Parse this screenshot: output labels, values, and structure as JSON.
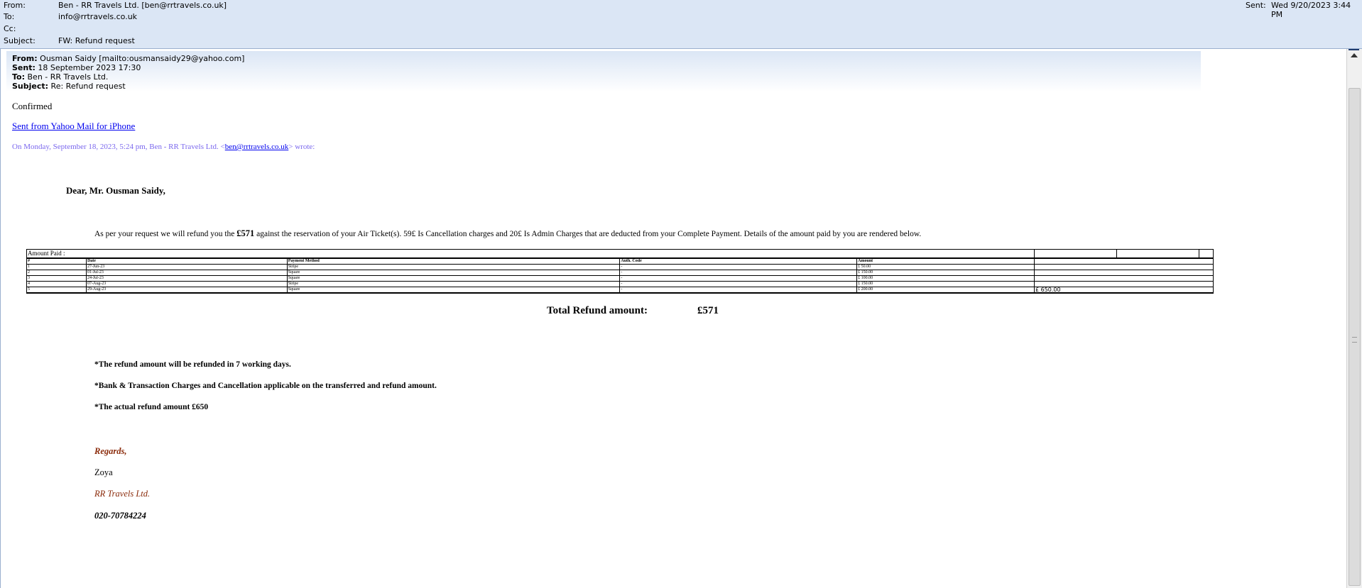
{
  "header": {
    "from_label": "From:",
    "from_value": "Ben - RR Travels Ltd. [ben@rrtravels.co.uk]",
    "to_label": "To:",
    "to_value": "info@rrtravels.co.uk",
    "cc_label": "Cc:",
    "cc_value": "",
    "subject_label": "Subject:",
    "subject_value": "FW: Refund request",
    "sent_label": "Sent:",
    "sent_value": "Wed 9/20/2023 3:44 PM"
  },
  "forwarded": {
    "from_label": "From:",
    "from_value": "Ousman Saidy [mailto:ousmansaidy29@yahoo.com]",
    "sent_label": "Sent:",
    "sent_value": "18 September 2023 17:30",
    "to_label": "To:",
    "to_value": "Ben - RR Travels Ltd.",
    "subject_label": "Subject:",
    "subject_value": "Re: Refund request"
  },
  "message": {
    "confirmed": "Confirmed",
    "yahoo_link": "Sent from Yahoo Mail for iPhone",
    "quote_prefix": "On Monday, September 18, 2023, 5:24 pm, Ben - RR Travels Ltd. <",
    "quote_email": "ben@rrtravels.co.uk",
    "quote_suffix": "> wrote:",
    "greeting": "Dear, Mr. Ousman Saidy,",
    "body_pre": "As per your request we will refund you the ",
    "body_amount": "£571",
    "body_post": " against the reservation of your Air Ticket(s). 59£ Is Cancellation charges and 20£ Is Admin Charges that are deducted from your Complete Payment. Details of the amount paid by you are rendered below.",
    "total_label": "Total Refund amount:",
    "total_value": "£571",
    "note1": "*The refund amount will be refunded in 7 working days.",
    "note2": "*Bank & Transaction Charges and Cancellation applicable on the transferred and refund amount.",
    "note3": "*The actual refund amount £650",
    "regards": "Regards,",
    "name": "Zoya",
    "company": "RR Travels Ltd.",
    "phone": "020-70784224"
  },
  "payments": {
    "caption": "Amount Paid :",
    "headers": [
      "#",
      "Date",
      "Payment Method",
      "Auth. Code",
      "Amount"
    ],
    "rows": [
      [
        "1",
        "27-Jun-23",
        "Stripe",
        "-",
        "£ 50.00"
      ],
      [
        "2",
        "01-Jul-23",
        "Square",
        "-",
        "£ 150.00"
      ],
      [
        "3",
        "24-Jul-23",
        "Square",
        "-",
        "£ 100.00"
      ],
      [
        "4",
        "07-Aug-23",
        "Stripe",
        "-",
        "£ 150.00"
      ],
      [
        "5",
        "29-Aug-23",
        "Square",
        "-",
        "£ 200.00"
      ]
    ],
    "total": "£ 650.00"
  },
  "colors": {
    "header_bg": "#dbe6f5",
    "link": "#0000ee",
    "quote": "#7b68ee",
    "signature": "#8b2c0c"
  }
}
